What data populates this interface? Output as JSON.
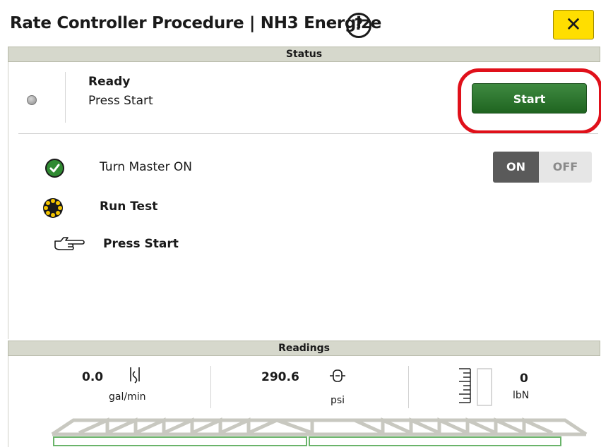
{
  "window": {
    "title": "Rate Controller Procedure | NH3 Energize",
    "help_label": "?",
    "close_label": "✕"
  },
  "status": {
    "header": "Status",
    "state_title": "Ready",
    "state_sub": "Press Start",
    "start_label": "Start",
    "steps": [
      {
        "label": "Turn Master ON",
        "status": "complete"
      },
      {
        "label": "Run Test",
        "status": "in-progress"
      },
      {
        "label": "Press Start",
        "status": "current"
      }
    ],
    "toggle": {
      "on_label": "ON",
      "off_label": "OFF",
      "selected": "ON"
    }
  },
  "readings": {
    "header": "Readings",
    "flow": {
      "value": "0.0",
      "unit": "gal/min",
      "icon": "flow-meter-icon"
    },
    "pressure": {
      "value": "290.6",
      "unit": "psi",
      "icon": "tank-pressure-icon"
    },
    "rate": {
      "value": "0",
      "unit": "lbN",
      "icon": "level-gauge-icon"
    }
  },
  "colors": {
    "start_button": "#2e7d32",
    "close_button": "#ffde00",
    "highlight": "#e0101a",
    "section_header": "#d6d8cc"
  }
}
